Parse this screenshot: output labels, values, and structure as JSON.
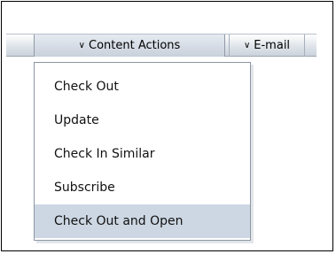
{
  "toolbar": {
    "content_actions_label": "Content Actions",
    "email_label": "E-mail"
  },
  "menu": {
    "items": [
      {
        "label": "Check Out"
      },
      {
        "label": "Update"
      },
      {
        "label": "Check In Similar"
      },
      {
        "label": "Subscribe"
      },
      {
        "label": "Check Out and Open",
        "highlighted": true
      }
    ]
  },
  "colors": {
    "highlight": "#cdd7e3",
    "border": "#8d97a3"
  }
}
